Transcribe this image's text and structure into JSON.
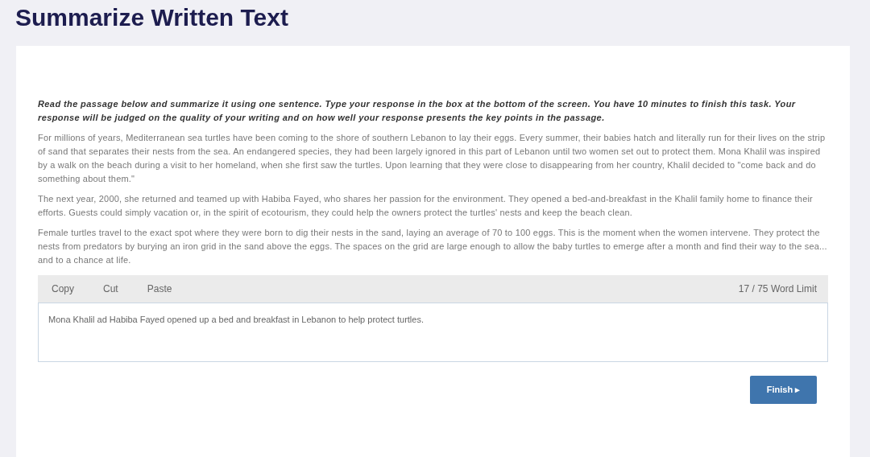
{
  "title": "Summarize Written Text",
  "instructions": "Read the passage below and summarize it using one sentence. Type your response in the box at the bottom of the screen. You have 10 minutes to finish this task. Your response will be judged on the quality of your writing and on how well your response presents the key points in the passage.",
  "passage": [
    "For millions of years, Mediterranean sea turtles have been coming to the shore of southern Lebanon to lay their eggs. Every summer, their babies hatch and literally run for their lives on the strip of sand that separates their nests from the sea. An endangered species, they had been largely ignored in this part of Lebanon until two women set out to protect them. Mona Khalil was inspired by a walk on the beach during a visit to her homeland, when she first saw the turtles. Upon learning that they were close to disappearing from her country, Khalil decided to \"come back and do something about them.\"",
    "The next year, 2000, she returned and teamed up with Habiba Fayed, who shares her passion for the environment. They opened a bed-and-breakfast in the Khalil family home to finance their efforts. Guests could simply vacation or, in the spirit of ecotourism, they could help the owners protect the turtles' nests and keep the beach clean.",
    "Female turtles travel to the exact spot where they were born to dig their nests in the sand, laying an average of 70 to 100 eggs. This is the moment when the women intervene. They protect the nests from predators by burying an iron grid in the sand above the eggs. The spaces on the grid are large enough to allow the baby turtles to emerge after a month and find their way to the sea... and to a chance at life."
  ],
  "toolbar": {
    "buttons": [
      "Copy",
      "Cut",
      "Paste"
    ],
    "word_count": "17 / 75 Word Limit"
  },
  "response": {
    "value": "Mona Khalil ad Habiba Fayed opened up a bed and breakfast in Lebanon to help protect turtles."
  },
  "finish_button": "Finish ▸"
}
